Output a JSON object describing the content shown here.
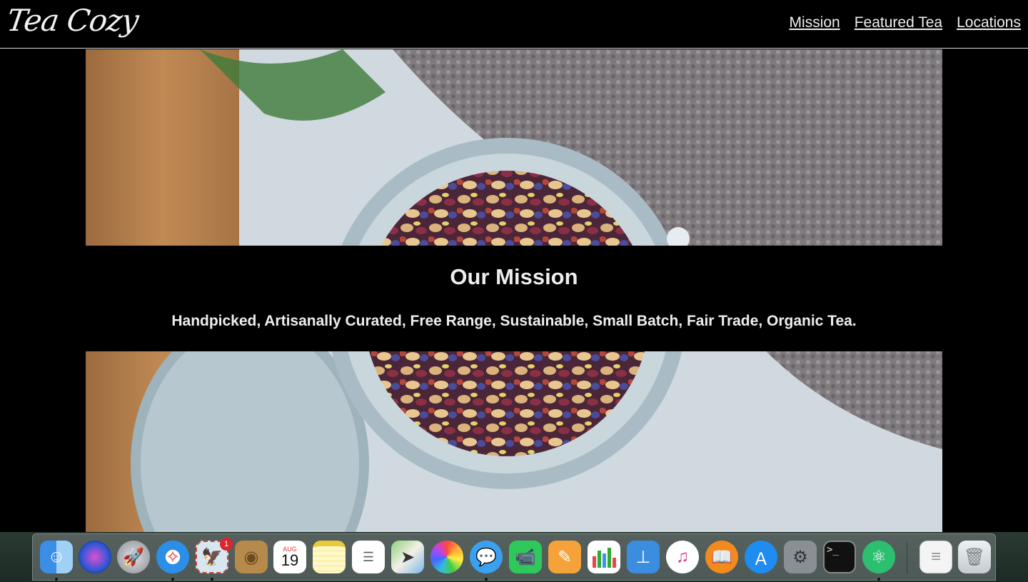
{
  "header": {
    "logo": "Tea Cozy",
    "nav": [
      "Mission",
      "Featured Tea",
      "Locations"
    ]
  },
  "mission": {
    "title": "Our Mission",
    "subtitle": "Handpicked, Artisanally Curated, Free Range, Sustainable, Small Batch, Fair Trade, Organic Tea."
  },
  "dock": {
    "calendar_month": "AUG",
    "calendar_day": "19",
    "mail_badge": "1",
    "apps": [
      "Finder",
      "Siri",
      "Launchpad",
      "Safari",
      "Mail",
      "Contacts",
      "Calendar",
      "Notes",
      "Reminders",
      "Maps",
      "Photos",
      "Messages",
      "FaceTime",
      "Pages",
      "Numbers",
      "Keynote",
      "iTunes",
      "iBooks",
      "App Store",
      "System Preferences",
      "Terminal",
      "Atom",
      "Documents",
      "Trash"
    ]
  },
  "colors": {
    "background": "#000000",
    "text": "#eeeeee",
    "header_border": "#d8d8d8"
  }
}
